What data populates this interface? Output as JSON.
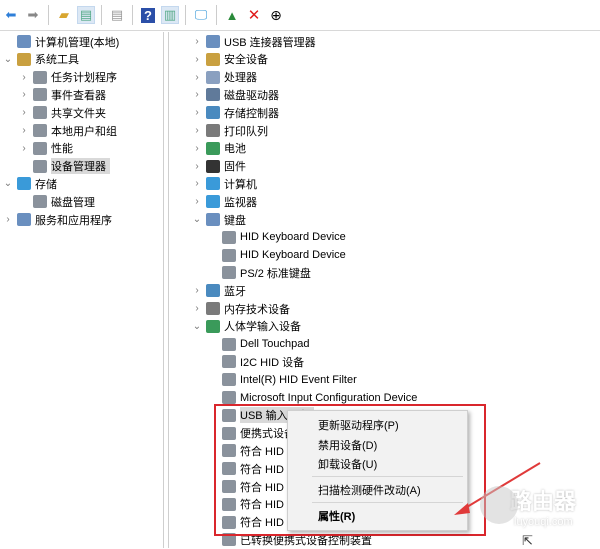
{
  "toolbar": {
    "icons": [
      "back-arrow-icon",
      "forward-arrow-icon",
      "up-folder-icon",
      "show-hide-tree-icon",
      "properties-icon",
      "help-icon",
      "action-pane-icon",
      "monitor-icon",
      "update-driver-icon",
      "uninstall-x-icon",
      "download-circle-icon"
    ]
  },
  "left_tree": [
    {
      "label": "计算机管理(本地)",
      "level": 0,
      "chev": ""
    },
    {
      "label": "系统工具",
      "level": 0,
      "chev": "v"
    },
    {
      "label": "任务计划程序",
      "level": 1,
      "chev": ">"
    },
    {
      "label": "事件查看器",
      "level": 1,
      "chev": ">"
    },
    {
      "label": "共享文件夹",
      "level": 1,
      "chev": ">"
    },
    {
      "label": "本地用户和组",
      "level": 1,
      "chev": ">"
    },
    {
      "label": "性能",
      "level": 1,
      "chev": ">"
    },
    {
      "label": "设备管理器",
      "level": 1,
      "chev": "",
      "selected": true
    },
    {
      "label": "存储",
      "level": 0,
      "chev": "v"
    },
    {
      "label": "磁盘管理",
      "level": 1,
      "chev": ""
    },
    {
      "label": "服务和应用程序",
      "level": 0,
      "chev": ">"
    }
  ],
  "right_tree": [
    {
      "label": "USB 连接器管理器",
      "level": 0,
      "chev": ">"
    },
    {
      "label": "安全设备",
      "level": 0,
      "chev": ">"
    },
    {
      "label": "处理器",
      "level": 0,
      "chev": ">"
    },
    {
      "label": "磁盘驱动器",
      "level": 0,
      "chev": ">"
    },
    {
      "label": "存储控制器",
      "level": 0,
      "chev": ">"
    },
    {
      "label": "打印队列",
      "level": 0,
      "chev": ">"
    },
    {
      "label": "电池",
      "level": 0,
      "chev": ">"
    },
    {
      "label": "固件",
      "level": 0,
      "chev": ">"
    },
    {
      "label": "计算机",
      "level": 0,
      "chev": ">"
    },
    {
      "label": "监视器",
      "level": 0,
      "chev": ">"
    },
    {
      "label": "键盘",
      "level": 0,
      "chev": "v"
    },
    {
      "label": "HID Keyboard Device",
      "level": 1,
      "chev": ""
    },
    {
      "label": "HID Keyboard Device",
      "level": 1,
      "chev": ""
    },
    {
      "label": "PS/2 标准键盘",
      "level": 1,
      "chev": ""
    },
    {
      "label": "蓝牙",
      "level": 0,
      "chev": ">"
    },
    {
      "label": "内存技术设备",
      "level": 0,
      "chev": ">"
    },
    {
      "label": "人体学输入设备",
      "level": 0,
      "chev": "v"
    },
    {
      "label": "Dell Touchpad",
      "level": 1,
      "chev": ""
    },
    {
      "label": "I2C HID 设备",
      "level": 1,
      "chev": ""
    },
    {
      "label": "Intel(R) HID Event Filter",
      "level": 1,
      "chev": ""
    },
    {
      "label": "Microsoft Input Configuration Device",
      "level": 1,
      "chev": ""
    },
    {
      "label": "USB 输入设备",
      "level": 1,
      "chev": "",
      "selected": true
    },
    {
      "label": "便携式设备",
      "level": 1,
      "chev": ""
    },
    {
      "label": "符合 HID",
      "level": 1,
      "chev": ""
    },
    {
      "label": "符合 HID",
      "level": 1,
      "chev": ""
    },
    {
      "label": "符合 HID",
      "level": 1,
      "chev": ""
    },
    {
      "label": "符合 HID",
      "level": 1,
      "chev": ""
    },
    {
      "label": "符合 HID",
      "level": 1,
      "chev": ""
    },
    {
      "label": "已转换便携式设备控制装置",
      "level": 1,
      "chev": ""
    }
  ],
  "context_menu": {
    "update_driver": "更新驱动程序(P)",
    "disable": "禁用设备(D)",
    "uninstall": "卸载设备(U)",
    "scan": "扫描检测硬件改动(A)",
    "properties": "属性(R)"
  },
  "watermark": {
    "title": "路由器",
    "url": "luyouqi.com"
  },
  "colors": {
    "highlight": "#d9262c",
    "selection": "#d9d9d9"
  }
}
